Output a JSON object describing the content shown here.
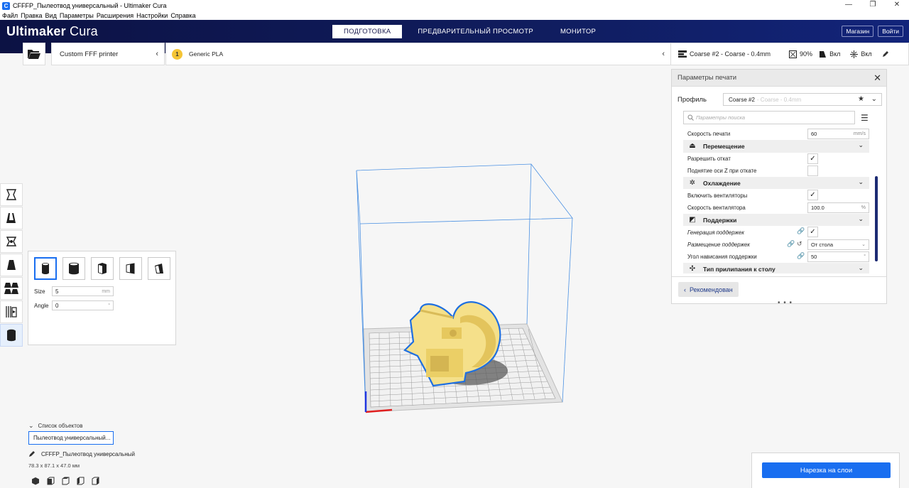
{
  "window": {
    "title": "CFFFP_Пылеотвод универсальный - Ultimaker Cura",
    "minimize": "—",
    "restore": "❐",
    "close": "✕"
  },
  "menu": [
    "Файл",
    "Правка",
    "Вид",
    "Параметры",
    "Расширения",
    "Настройки",
    "Справка"
  ],
  "header": {
    "logo_bold": "Ultimaker",
    "logo_light": "Cura",
    "stages": [
      "ПОДГОТОВКА",
      "ПРЕДВАРИТЕЛЬНЫЙ ПРОСМОТР",
      "МОНИТОР"
    ],
    "active_stage": 0,
    "marketplace": "Магазин",
    "signin": "Войти"
  },
  "toolbar": {
    "printer": "Custom FFF printer",
    "material": "Generic PLA",
    "material_badge": "1",
    "profile_summary": "Coarse #2 - Coarse - 0.4mm",
    "infill": "90%",
    "support": "Вкл",
    "adhesion": "Вкл"
  },
  "tool_panel": {
    "size_label": "Size",
    "size_value": "5",
    "size_unit": "mm",
    "angle_label": "Angle",
    "angle_value": "0",
    "angle_unit": "°"
  },
  "settings": {
    "title": "Параметры печати",
    "profile_label": "Профиль",
    "profile_name": "Coarse #2",
    "profile_sub": " - Coarse - 0.4mm",
    "search_placeholder": "Параметры поиска",
    "rows": {
      "print_speed": {
        "name": "Скорость печати",
        "value": "60",
        "unit": "mm/s"
      },
      "travel": "Перемещение",
      "retraction": "Разрешить откат",
      "z_hop": "Поднятие оси Z при откате",
      "cooling": "Охлаждение",
      "fans": "Включить вентиляторы",
      "fan_speed": {
        "name": "Скорость вентилятора",
        "value": "100.0",
        "unit": "%"
      },
      "support": "Поддержки",
      "support_gen": "Генерация поддержек",
      "support_place": {
        "name": "Размещение поддержек",
        "value": "От стола"
      },
      "support_angle": {
        "name": "Угол нависания поддержки",
        "value": "50",
        "unit": "°"
      },
      "adhesion": "Тип прилипания к столу"
    },
    "recommended": "Рекомендован",
    "drag_handle": "• • •"
  },
  "objects": {
    "list_label": "Список объектов",
    "item": "Пылеотвод универсальный...",
    "selected_name": "CFFFP_Пылеотвод универсальный",
    "dimensions": "78.3 x 87.1 x 47.0 мм"
  },
  "slice": {
    "label": "Нарезка на слои"
  },
  "colors": {
    "accent": "#196ef0",
    "header": "#101d5f",
    "model": "#f5e08a",
    "outline": "#1f6fe0"
  }
}
